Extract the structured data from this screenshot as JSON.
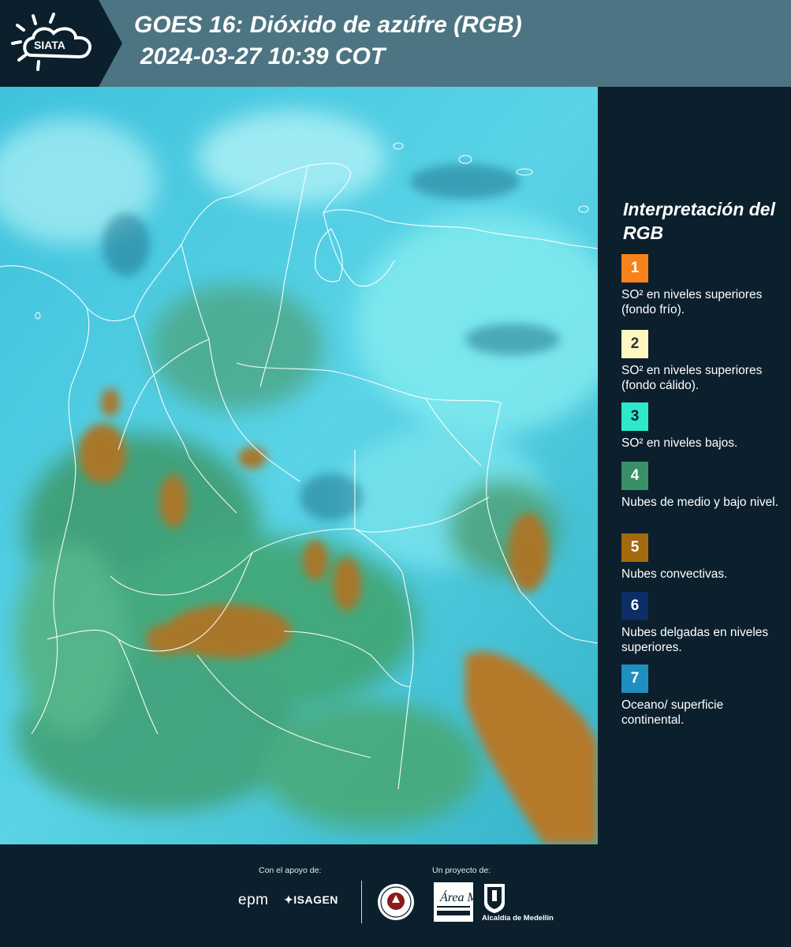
{
  "header": {
    "logo_text": "SIATA",
    "title": "GOES 16: Dióxido de azúfre (RGB)",
    "timestamp": "2024-03-27 10:39 COT",
    "background_color": "#4d7482",
    "logo_panel_color": "#0b1f2c"
  },
  "map": {
    "product": "Sulfur dioxide RGB composite",
    "boundary_color": "#ffffff"
  },
  "legend": {
    "title": "Interpretación del RGB",
    "items": [
      {
        "number": "1",
        "color": "#f7821b",
        "label": "SO² en niveles superiores (fondo frío)."
      },
      {
        "number": "2",
        "color": "#fff7c2",
        "label": "SO² en niveles superiores (fondo cálido)."
      },
      {
        "number": "3",
        "color": "#2ee8cc",
        "label": "SO² en niveles bajos."
      },
      {
        "number": "4",
        "color": "#3a8f66",
        "label": "Nubes de medio y bajo nivel."
      },
      {
        "number": "5",
        "color": "#a46a0f",
        "label": "Nubes convectivas."
      },
      {
        "number": "6",
        "color": "#0d2d66",
        "label": "Nubes delgadas en niveles superiores."
      },
      {
        "number": "7",
        "color": "#1f8fbf",
        "label": "Oceano/ superficie continental."
      }
    ]
  },
  "footer": {
    "support_label": "Con el apoyo de:",
    "project_label": "Un proyecto de:",
    "sponsors": [
      "epm",
      "ISAGEN"
    ],
    "partners": [
      "Área Metropolitana",
      "Alcaldía de Medellín"
    ],
    "alcaldia_label": "Alcaldía de Medellín"
  }
}
